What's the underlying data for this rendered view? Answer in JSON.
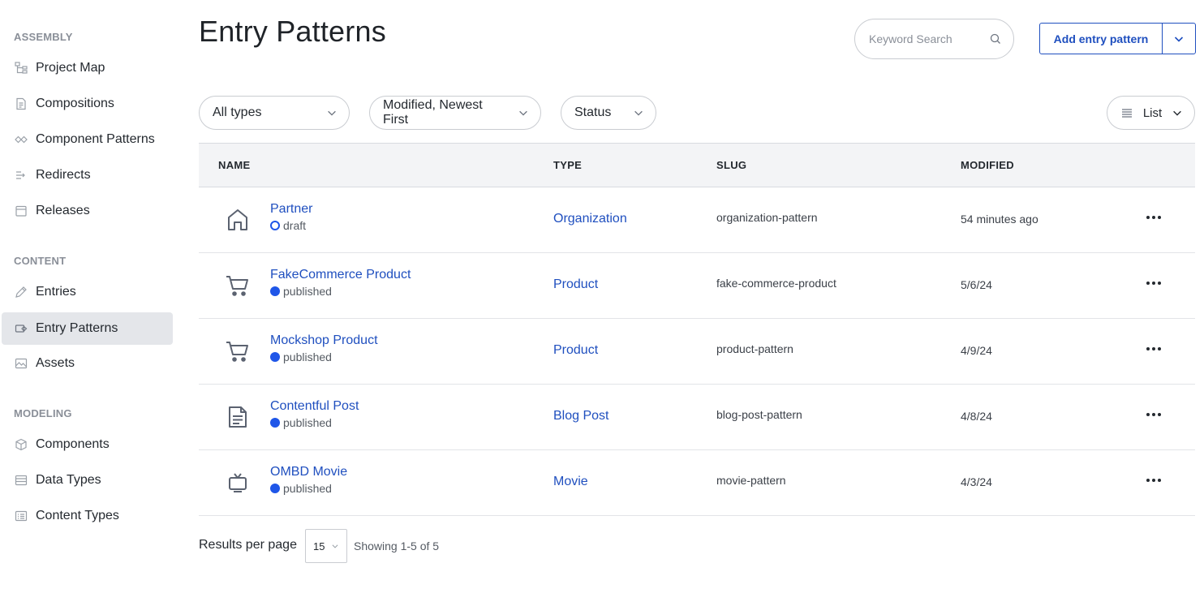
{
  "sidebar": {
    "sections": [
      {
        "title": "ASSEMBLY",
        "items": [
          {
            "label": "Project Map",
            "icon": "project-map-icon"
          },
          {
            "label": "Compositions",
            "icon": "composition-icon"
          },
          {
            "label": "Component Patterns",
            "icon": "component-pattern-icon"
          },
          {
            "label": "Redirects",
            "icon": "redirect-icon"
          },
          {
            "label": "Releases",
            "icon": "release-icon"
          }
        ]
      },
      {
        "title": "CONTENT",
        "items": [
          {
            "label": "Entries",
            "icon": "pencil-icon"
          },
          {
            "label": "Entry Patterns",
            "icon": "entry-pattern-icon",
            "active": true
          },
          {
            "label": "Assets",
            "icon": "image-icon"
          }
        ]
      },
      {
        "title": "MODELING",
        "items": [
          {
            "label": "Components",
            "icon": "cube-icon"
          },
          {
            "label": "Data Types",
            "icon": "data-type-icon"
          },
          {
            "label": "Content Types",
            "icon": "content-type-icon"
          }
        ]
      }
    ]
  },
  "header": {
    "title": "Entry Patterns",
    "search_placeholder": "Keyword Search",
    "add_button": "Add entry pattern"
  },
  "filters": {
    "type": "All types",
    "sort": "Modified, Newest First",
    "status": "Status",
    "view": "List"
  },
  "table": {
    "columns": [
      "NAME",
      "TYPE",
      "SLUG",
      "MODIFIED"
    ],
    "rows": [
      {
        "name": "Partner",
        "status": "draft",
        "type": "Organization",
        "slug": "organization-pattern",
        "modified": "54 minutes ago",
        "icon": "home-icon"
      },
      {
        "name": "FakeCommerce Product",
        "status": "published",
        "type": "Product",
        "slug": "fake-commerce-product",
        "modified": "5/6/24",
        "icon": "cart-icon"
      },
      {
        "name": "Mockshop Product",
        "status": "published",
        "type": "Product",
        "slug": "product-pattern",
        "modified": "4/9/24",
        "icon": "cart-icon"
      },
      {
        "name": "Contentful Post",
        "status": "published",
        "type": "Blog Post",
        "slug": "blog-post-pattern",
        "modified": "4/8/24",
        "icon": "document-icon"
      },
      {
        "name": "OMBD Movie",
        "status": "published",
        "type": "Movie",
        "slug": "movie-pattern",
        "modified": "4/3/24",
        "icon": "tv-icon"
      }
    ]
  },
  "footer": {
    "results_per_page_label": "Results per page",
    "results_per_page_value": "15",
    "showing": "Showing 1-5 of 5"
  },
  "colors": {
    "accent": "#1f4fbf",
    "status_dot": "#1f56e8",
    "active_nav_bg": "#e4e6ea",
    "header_bg": "#f3f4f6"
  }
}
